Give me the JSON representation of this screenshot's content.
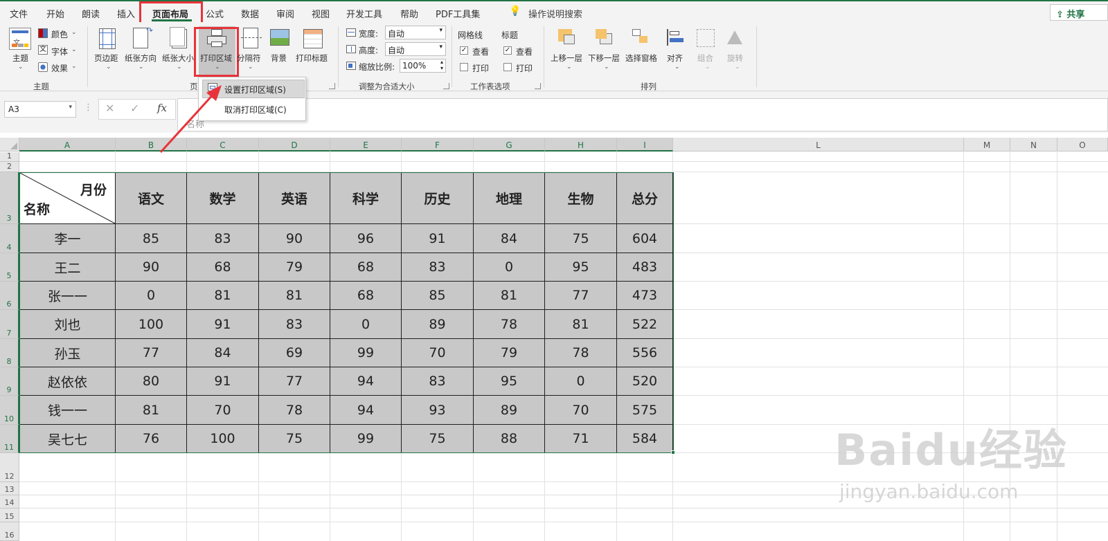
{
  "menubar": {
    "tabs": [
      "文件",
      "开始",
      "朗读",
      "插入",
      "页面布局",
      "公式",
      "数据",
      "审阅",
      "视图",
      "开发工具",
      "帮助",
      "PDF工具集"
    ],
    "active_tab": "页面布局",
    "search": "操作说明搜索",
    "share": "共享"
  },
  "ribbon": {
    "theme": {
      "themes": "主题",
      "colors": "颜色",
      "fonts": "字体",
      "effects": "效果",
      "group": "主题"
    },
    "page_setup": {
      "margins": "页边距",
      "orientation": "纸张方向",
      "size": "纸张大小",
      "print_area": "打印区域",
      "breaks": "分隔符",
      "background": "背景",
      "print_titles": "打印标题",
      "group": "页"
    },
    "scale": {
      "width_label": "宽度:",
      "width_value": "自动",
      "height_label": "高度:",
      "height_value": "自动",
      "scale_label": "缩放比例:",
      "scale_value": "100%",
      "group": "调整为合适大小"
    },
    "sheet_options": {
      "gridlines": "网格线",
      "headings": "标题",
      "view": "查看",
      "print": "打印",
      "group": "工作表选项"
    },
    "arrange": {
      "bring_forward": "上移一层",
      "send_backward": "下移一层",
      "selection_pane": "选择窗格",
      "align": "对齐",
      "group_btn": "组合",
      "rotate": "旋转",
      "group": "排列"
    }
  },
  "dropdown_menu": {
    "items": [
      "设置打印区域(S)",
      "取消打印区域(C)"
    ]
  },
  "formula_bar": {
    "name_box": "A3",
    "fx": "fx",
    "content": "名称"
  },
  "columns": [
    "A",
    "B",
    "C",
    "D",
    "E",
    "F",
    "G",
    "H",
    "I",
    "L",
    "M",
    "N",
    "O"
  ],
  "rows": [
    "1",
    "2",
    "3",
    "4",
    "5",
    "6",
    "7",
    "8",
    "9",
    "10",
    "11",
    "12",
    "13",
    "14",
    "15",
    "16"
  ],
  "table": {
    "corner_top": "月份",
    "corner_bottom": "名称",
    "headers": [
      "语文",
      "数学",
      "英语",
      "科学",
      "历史",
      "地理",
      "生物",
      "总分"
    ],
    "rows": [
      {
        "name": "李一",
        "values": [
          "85",
          "83",
          "90",
          "96",
          "91",
          "84",
          "75",
          "604"
        ]
      },
      {
        "name": "王二",
        "values": [
          "90",
          "68",
          "79",
          "68",
          "83",
          "0",
          "95",
          "483"
        ]
      },
      {
        "name": "张一一",
        "values": [
          "0",
          "81",
          "81",
          "68",
          "85",
          "81",
          "77",
          "473"
        ]
      },
      {
        "name": "刘也",
        "values": [
          "100",
          "91",
          "83",
          "0",
          "89",
          "78",
          "81",
          "522"
        ]
      },
      {
        "name": "孙玉",
        "values": [
          "77",
          "84",
          "69",
          "99",
          "70",
          "79",
          "78",
          "556"
        ]
      },
      {
        "name": "赵依依",
        "values": [
          "80",
          "91",
          "77",
          "94",
          "83",
          "95",
          "0",
          "520"
        ]
      },
      {
        "name": "钱一一",
        "values": [
          "81",
          "70",
          "78",
          "94",
          "93",
          "89",
          "70",
          "575"
        ]
      },
      {
        "name": "吴七七",
        "values": [
          "76",
          "100",
          "75",
          "99",
          "75",
          "88",
          "71",
          "584"
        ]
      }
    ]
  },
  "watermark": {
    "brand": "Baidu经验",
    "url": "jingyan.baidu.com"
  },
  "colors": {
    "accent": "#217346",
    "highlight": "#e8333a",
    "cell_fill": "#c8c8c8"
  }
}
